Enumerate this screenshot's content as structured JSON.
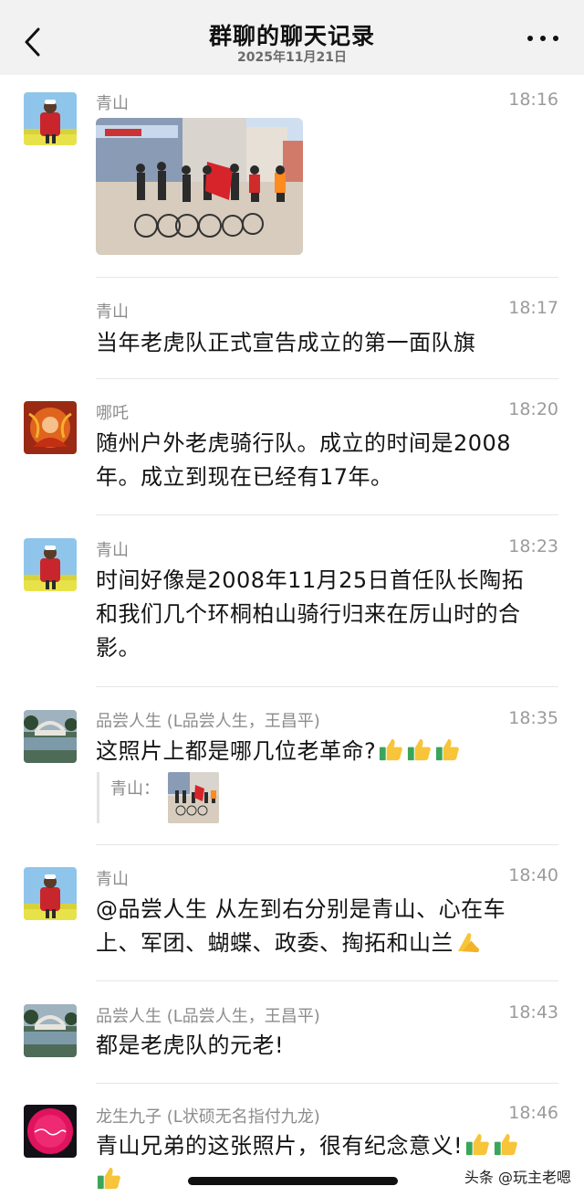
{
  "header": {
    "title": "群聊的聊天记录",
    "date": "2025年11月21日"
  },
  "messages": [
    {
      "sender": "青山",
      "time": "18:16",
      "type": "image"
    },
    {
      "sender": "青山",
      "time": "18:17",
      "text": "当年老虎队正式宣告成立的第一面队旗"
    },
    {
      "sender": "哪吒",
      "time": "18:20",
      "text_lines": [
        "随州户外老虎骑行队。成立的时间是2008",
        "年。成立到现在已经有17年。"
      ]
    },
    {
      "sender": "青山",
      "time": "18:23",
      "text_lines": [
        "时间好像是2008年11月25日首任队长陶拓",
        "和我们几个环桐柏山骑行归来在厉山时的合",
        "影。"
      ]
    },
    {
      "sender": "品尝人生 (L品尝人生，王昌平)",
      "time": "18:35",
      "text": "这照片上都是哪几位老革命?",
      "quote_label": "青山："
    },
    {
      "sender": "青山",
      "time": "18:40",
      "text_lines": [
        "@品尝人生 从左到右分别是青山、心在车",
        "上、军团、蝴蝶、政委、掏拓和山兰"
      ]
    },
    {
      "sender": "品尝人生 (L品尝人生，王昌平)",
      "time": "18:43",
      "text": "都是老虎队的元老!"
    },
    {
      "sender": "龙生九子 (L状硕无名指付九龙)",
      "time": "18:46",
      "text": "青山兄弟的这张照片，很有纪念意义!"
    }
  ],
  "watermark": "头条 @玩主老嗯",
  "colors": {
    "nav_bg": "#f2f2f2",
    "divider": "#e6e6e6",
    "meta_text": "#8c8c8c"
  },
  "icons": [
    "back-chevron-icon",
    "more-dots-icon",
    "thumbs-up-icon",
    "folded-hands-icon"
  ]
}
